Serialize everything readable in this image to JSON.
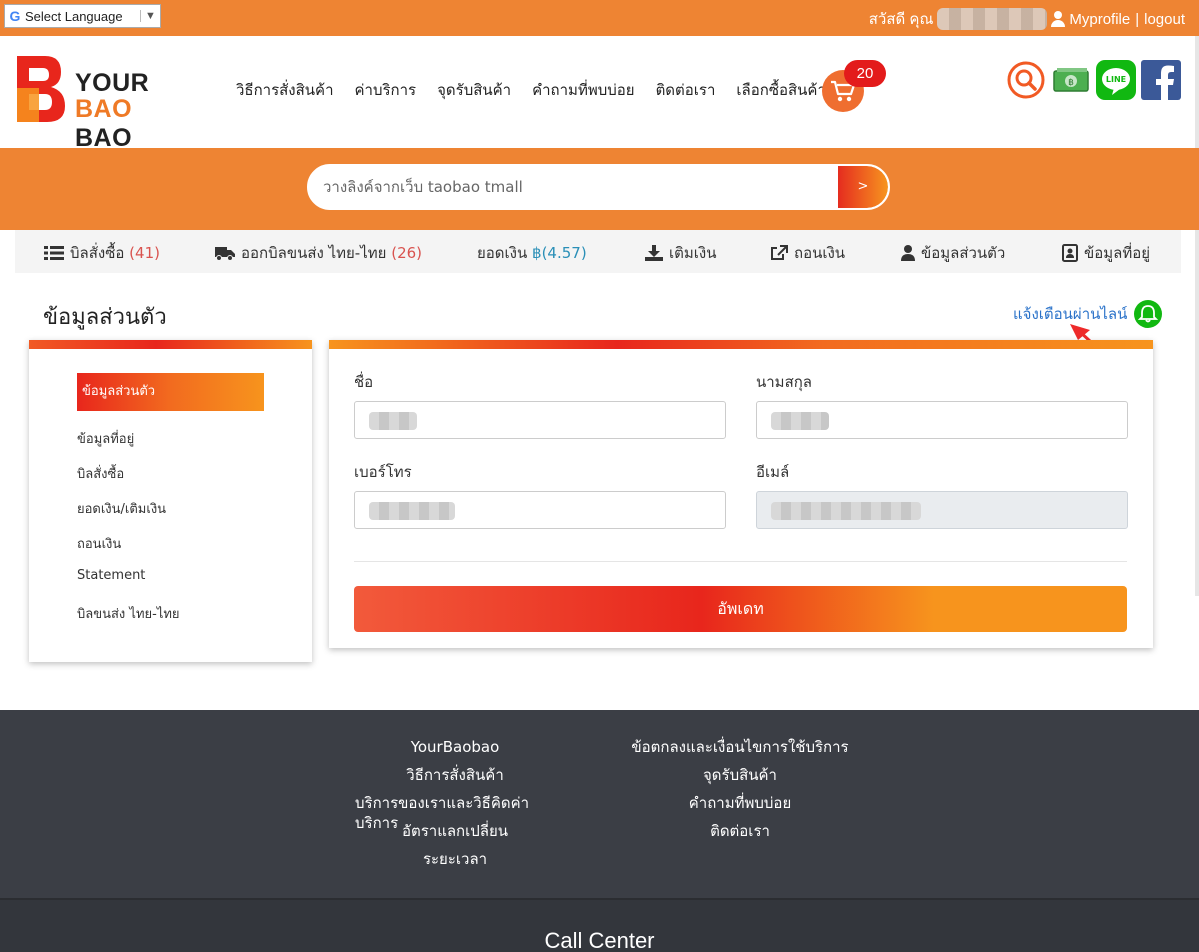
{
  "topbar": {
    "language_label": "Select Language",
    "greeting": "สวัสดี คุณ",
    "profile_link": "Myprofile",
    "separator": "|",
    "logout_link": "logout"
  },
  "logo": {
    "line1": "YOUR",
    "line2a": "BAO",
    "line2b": "BAO"
  },
  "nav": {
    "items": [
      "วิธีการสั่งสินค้า",
      "ค่าบริการ",
      "จุดรับสินค้า",
      "คำถามที่พบบ่อย",
      "ติดต่อเรา",
      "เลือกซื้อสินค้า"
    ],
    "cart_count": "20"
  },
  "search": {
    "placeholder": "วางลิงค์จากเว็บ taobao tmall",
    "button_label": ">"
  },
  "subnav": {
    "orders_label": "บิลสั่งซื้อ",
    "orders_count": "(41)",
    "shipping_label": "ออกบิลขนส่ง ไทย-ไทย",
    "shipping_count": "(26)",
    "balance_label": "ยอดเงิน",
    "balance_value": "฿(4.57)",
    "topup_label": "เติมเงิน",
    "withdraw_label": "ถอนเงิน",
    "profile_label": "ข้อมูลส่วนตัว",
    "address_label": "ข้อมูลที่อยู่"
  },
  "page": {
    "title": "ข้อมูลส่วนตัว",
    "line_alert": "แจ้งเตือนผ่านไลน์"
  },
  "sidebar": {
    "items": [
      "ข้อมูลส่วนตัว",
      "ข้อมูลที่อยู่",
      "บิลสั่งซื้อ",
      "ยอดเงิน/เติมเงิน",
      "ถอนเงิน",
      "Statement",
      "บิลขนส่ง ไทย-ไทย"
    ]
  },
  "form": {
    "first_name_label": "ชื่อ",
    "last_name_label": "นามสกุล",
    "phone_label": "เบอร์โทร",
    "email_label": "อีเมล์",
    "submit_label": "อัพเดท"
  },
  "footer": {
    "left": [
      "YourBaobao",
      "วิธีการสั่งสินค้า",
      "บริการของเราและวิธีคิดค่าบริการ",
      "อัตราแลกเปลี่ยน",
      "ระยะเวลา"
    ],
    "right": [
      "ข้อตกลงและเงื่อนไขการใช้บริการ",
      "จุดรับสินค้า",
      "คำถามที่พบบ่อย",
      "ติดต่อเรา"
    ],
    "call_center": "Call Center"
  },
  "colors": {
    "brand_orange": "#ee8433",
    "accent_red": "#e8261c",
    "footer_bg": "#3b3e45",
    "line_green": "#11b811"
  }
}
